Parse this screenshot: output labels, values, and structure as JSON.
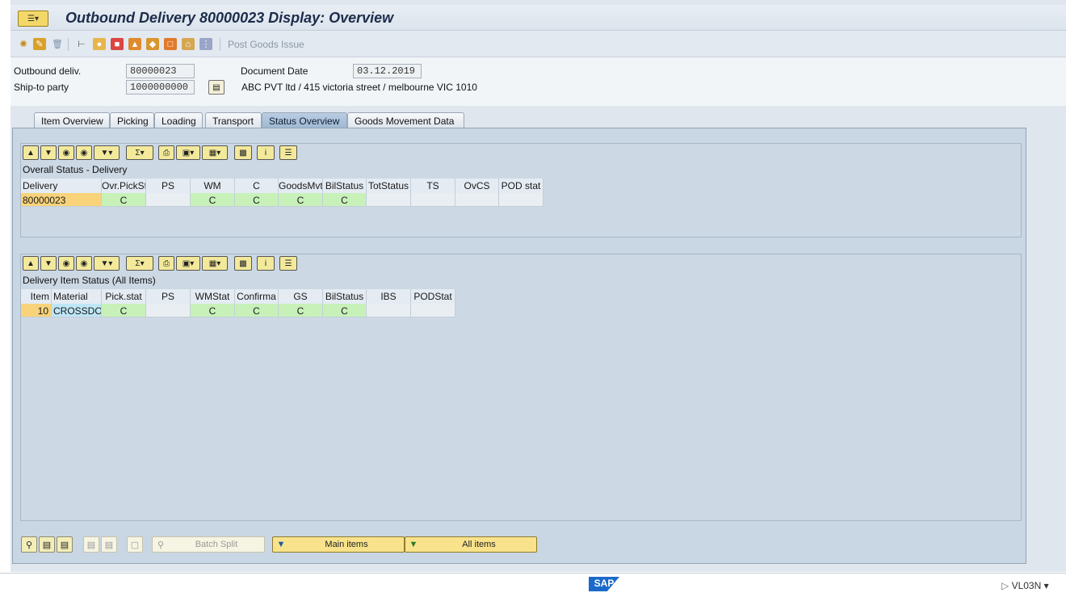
{
  "window": {
    "title": "Outbound Delivery 80000023 Display: Overview"
  },
  "toolbar": {
    "post_goods_issue_label": "Post Goods Issue"
  },
  "header": {
    "outbound_deliv_label": "Outbound deliv.",
    "outbound_deliv_value": "80000023",
    "document_date_label": "Document Date",
    "document_date_value": "03.12.2019",
    "ship_to_party_label": "Ship-to party",
    "ship_to_party_value": "1000000000",
    "ship_to_party_address": "ABC PVT ltd / 415 victoria street / melbourne VIC 1010"
  },
  "tabs": [
    {
      "label": "Item Overview"
    },
    {
      "label": "Picking"
    },
    {
      "label": "Loading"
    },
    {
      "label": "Transport"
    },
    {
      "label": "Status Overview"
    },
    {
      "label": "Goods Movement Data"
    }
  ],
  "overall_status": {
    "title": "Overall Status - Delivery",
    "columns": [
      "Delivery",
      "Ovr.PickSt",
      "PS",
      "WM",
      "C",
      "GoodsMvt",
      "BilStatus",
      "TotStatus",
      "TS",
      "OvCS",
      "POD stat"
    ],
    "row": [
      "80000023",
      "C",
      "",
      "C",
      "C",
      "C",
      "C",
      "",
      "",
      "",
      ""
    ]
  },
  "item_status": {
    "title": "Delivery Item Status (All Items)",
    "columns": [
      "Item",
      "Material",
      "Pick.stat",
      "PS",
      "WMStat",
      "Confirma",
      "GS",
      "BilStatus",
      "IBS",
      "PODStat"
    ],
    "row": [
      "10",
      "CROSSDO",
      "C",
      "",
      "C",
      "C",
      "C",
      "C",
      "",
      ""
    ]
  },
  "bottom": {
    "batch_split_label": "Batch Split",
    "main_items_label": "Main items",
    "all_items_label": "All items"
  },
  "statusbar": {
    "logo": "SAP",
    "tcode": "VL03N"
  },
  "colors": {
    "status_green": "#c7f1b9",
    "key_orange": "#f8d37a",
    "active_tab": "#a8bfd7"
  }
}
